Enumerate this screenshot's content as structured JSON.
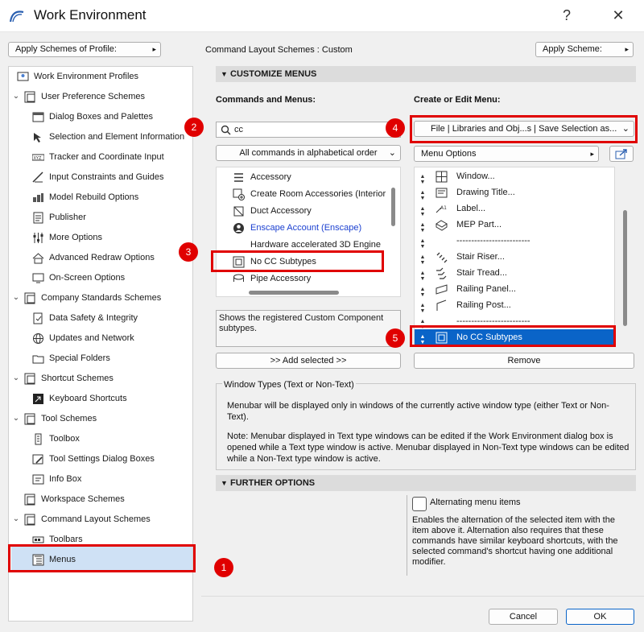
{
  "window": {
    "title": "Work Environment",
    "help_glyph": "?",
    "close_glyph": "✕"
  },
  "top_bar": {
    "apply_profile_label": "Apply Schemes of Profile:",
    "command_layout_label": "Command Layout Schemes :",
    "command_layout_value": "Custom",
    "apply_scheme_label": "Apply Scheme:"
  },
  "sidebar": {
    "items": [
      {
        "label": "Work Environment Profiles"
      },
      {
        "label": "User Preference Schemes"
      },
      {
        "label": "Dialog Boxes and Palettes"
      },
      {
        "label": "Selection and Element Information"
      },
      {
        "label": "Tracker and Coordinate Input"
      },
      {
        "label": "Input Constraints and Guides"
      },
      {
        "label": "Model Rebuild Options"
      },
      {
        "label": "Publisher"
      },
      {
        "label": "More Options"
      },
      {
        "label": "Advanced Redraw Options"
      },
      {
        "label": "On-Screen Options"
      },
      {
        "label": "Company Standards Schemes"
      },
      {
        "label": "Data Safety & Integrity"
      },
      {
        "label": "Updates and Network"
      },
      {
        "label": "Special Folders"
      },
      {
        "label": "Shortcut Schemes"
      },
      {
        "label": "Keyboard Shortcuts"
      },
      {
        "label": "Tool Schemes"
      },
      {
        "label": "Toolbox"
      },
      {
        "label": "Tool Settings Dialog Boxes"
      },
      {
        "label": "Info Box"
      },
      {
        "label": "Workspace Schemes"
      },
      {
        "label": "Command Layout Schemes"
      },
      {
        "label": "Toolbars"
      },
      {
        "label": "Menus"
      }
    ]
  },
  "customize": {
    "header": "CUSTOMIZE MENUS",
    "commands_label": "Commands and Menus:",
    "create_label": "Create or Edit Menu:",
    "search_value": "cc",
    "filter_value": "All commands in alphabetical order",
    "menu_select_value": "File | Libraries and Obj...s | Save Selection as...",
    "menu_options_value": "Menu Options",
    "commands": [
      {
        "label": "Accessory"
      },
      {
        "label": "Create Room Accessories (Interior"
      },
      {
        "label": "Duct Accessory"
      },
      {
        "label": "Enscape Account (Enscape)"
      },
      {
        "label": "Hardware accelerated 3D Engine"
      },
      {
        "label": "No CC Subtypes"
      },
      {
        "label": "Pipe Accessory"
      }
    ],
    "description": "Shows the registered Custom Component subtypes.",
    "add_selected_label": ">> Add selected >>",
    "menu_items": [
      {
        "label": "Window..."
      },
      {
        "label": "Drawing Title..."
      },
      {
        "label": "Label..."
      },
      {
        "label": "MEP Part..."
      },
      {
        "label": "-------------------------"
      },
      {
        "label": "Stair Riser..."
      },
      {
        "label": "Stair Tread..."
      },
      {
        "label": "Railing Panel..."
      },
      {
        "label": "Railing Post..."
      },
      {
        "label": "-------------------------"
      },
      {
        "label": "No CC Subtypes"
      }
    ],
    "remove_label": "Remove"
  },
  "window_types": {
    "title": "Window Types (Text or Non-Text)",
    "para1": "Menubar will be displayed only in windows of the currently active window type (either Text or Non-Text).",
    "para2": "Note: Menubar displayed in Text type windows can be edited if the Work Environment dialog box is opened while a Text type window is active. Menubar displayed in Non-Text type windows can be edited while a Non-Text type window is active."
  },
  "further": {
    "header": "FURTHER OPTIONS",
    "alternating_label": "Alternating menu items",
    "alternating_desc": "Enables the alternation of the selected item with the item above it. Alternation also requires that these commands have similar keyboard shortcuts, with the selected command's shortcut having one additional modifier."
  },
  "footer": {
    "cancel_label": "Cancel",
    "ok_label": "OK"
  },
  "callouts": [
    "1",
    "2",
    "3",
    "4",
    "5"
  ],
  "colors": {
    "highlight_red": "#e00000",
    "selection_blue": "#0a64c8",
    "link_blue": "#1a3fd0"
  }
}
